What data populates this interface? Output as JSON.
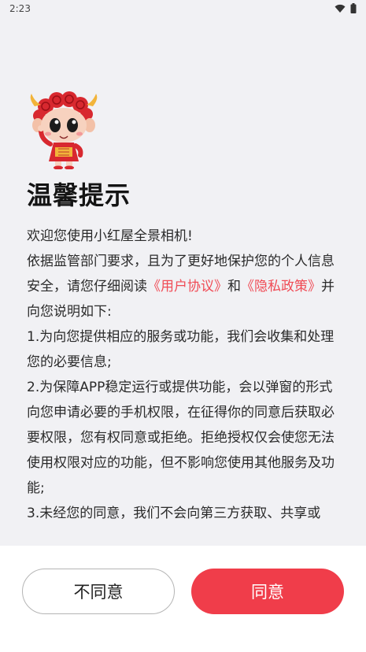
{
  "status_bar": {
    "time": "2:23"
  },
  "dialog": {
    "title": "温馨提示",
    "intro": "欢迎您使用小红屋全景相机!",
    "para1_before": "依据监管部门要求，且为了更好地保护您的个人信息安全，请您仔细阅读",
    "user_agreement_link": "《用户协议》",
    "and": "和",
    "privacy_policy_link": "《隐私政策》",
    "para1_after": "并向您说明如下:",
    "item1": "1.为向您提供相应的服务或功能，我们会收集和处理您的必要信息;",
    "item2": "2.为保障APP稳定运行或提供功能，会以弹窗的形式向您申请必要的手机权限，在征得你的同意后获取必要权限，您有权同意或拒绝。拒绝授权仅会使您无法使用权限对应的功能，但不影响您使用其他服务及功能;",
    "item3": "3.未经您的同意，我们不会向第三方获取、共享或"
  },
  "buttons": {
    "disagree": "不同意",
    "agree": "同意"
  },
  "colors": {
    "accent": "#f03d4a",
    "link": "#f04b55",
    "background": "#f1f1f4"
  },
  "icons": [
    "wifi-icon",
    "battery-icon",
    "mascot-illustration"
  ]
}
